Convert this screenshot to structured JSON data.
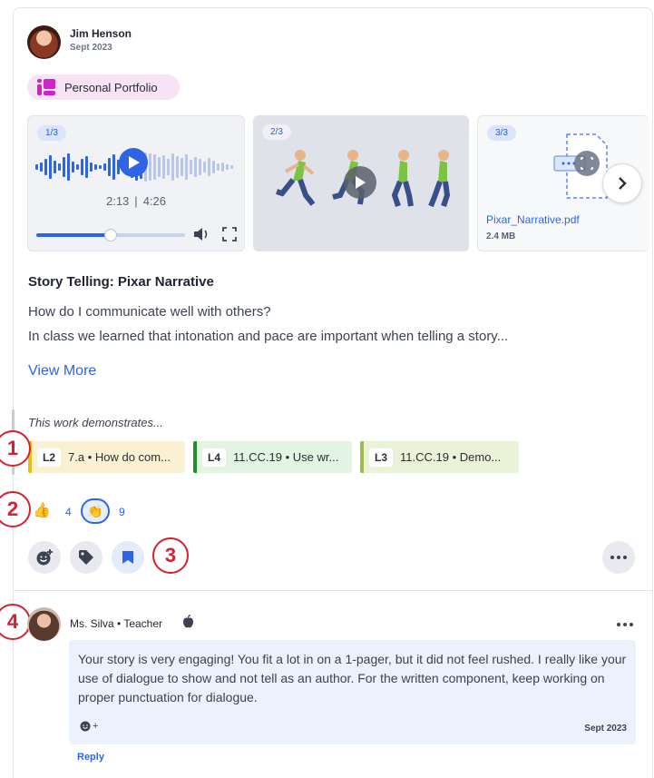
{
  "post": {
    "author": "Jim Henson",
    "date": "Sept 2023",
    "portfolio_label": "Personal Portfolio",
    "title": "Story Telling: Pixar Narrative",
    "lines": [
      "How do I communicate well with others?",
      "In class we learned that intonation and pace are important when telling a story..."
    ],
    "view_more": "View More"
  },
  "media": {
    "audio": {
      "counter": "1/3",
      "current_time": "2:13",
      "separator": "|",
      "duration": "4:26",
      "progress": 0.5
    },
    "video": {
      "counter": "2/3"
    },
    "document": {
      "counter": "3/3",
      "filename": "Pixar_Narrative.pdf",
      "size": "2.4 MB"
    }
  },
  "demonstrates": {
    "label": "This work demonstrates...",
    "standards": [
      {
        "level": "L2",
        "text": "7.a • How do com...",
        "bg": "#faf1d2",
        "edge": "#e2c21a"
      },
      {
        "level": "L4",
        "text": "11.CC.19 • Use wr...",
        "bg": "#e3f4e2",
        "edge": "#1f8f2b"
      },
      {
        "level": "L3",
        "text": "11.CC.19 • Demo...",
        "bg": "#eaf2d8",
        "edge": "#9dbb4f"
      }
    ]
  },
  "reactions": {
    "thumbs_count": "4",
    "clap_count": "9"
  },
  "markers": [
    "1",
    "2",
    "3",
    "4"
  ],
  "comment": {
    "author": "Ms. Silva • Teacher",
    "text": "Your story is very engaging! You fit a lot in on a 1-pager, but it did not feel rushed. I really like your use of dialogue to show and not tell as an author. For the written component, keep working on proper punctuation for dialogue.",
    "emoji_add": "+",
    "date": "Sept 2023",
    "reply": "Reply"
  },
  "colors": {
    "accent": "#2f64e6",
    "marker": "#d4202f",
    "portfolio": "#d223c9"
  }
}
